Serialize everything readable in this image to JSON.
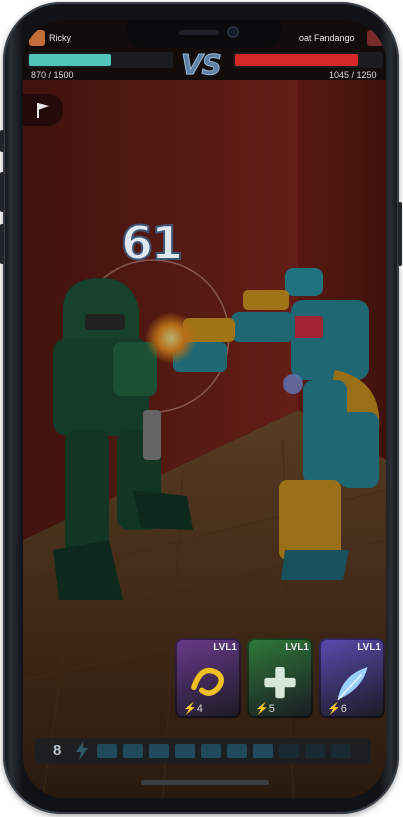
{
  "player": {
    "name": "Ricky",
    "hp_text": "870 / 1500",
    "hp_fraction": 0.58
  },
  "versus_label": "VS",
  "opponent": {
    "name": "oat Fandango",
    "hp_text": "1045 / 1250",
    "hp_fraction": 0.84
  },
  "hit_damage": "61",
  "cards": [
    {
      "level": "LVL1",
      "cost": "4",
      "color": "#6a3a8c",
      "icon": "swirl-icon"
    },
    {
      "level": "LVL1",
      "cost": "5",
      "color": "#2f7a3a",
      "icon": "plus-icon"
    },
    {
      "level": "LVL1",
      "cost": "6",
      "color": "#5a4bb0",
      "icon": "feather-icon"
    }
  ],
  "energy": {
    "count": "8",
    "filled_segments": 7,
    "total_segments": 10
  },
  "colors": {
    "player_hp": "#4fc7b8",
    "opponent_hp": "#d62828",
    "wall": "#8a2a20",
    "floor": "#6a4428"
  }
}
